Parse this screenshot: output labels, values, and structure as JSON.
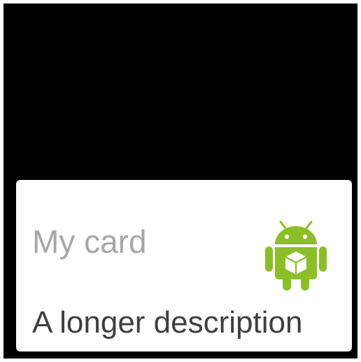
{
  "card": {
    "title": "My card",
    "description": "A longer description",
    "icon": "android-robot-cube-icon"
  },
  "colors": {
    "background": "#000000",
    "card": "#ffffff",
    "title": "#a7a7a7",
    "description": "#3f3f3f",
    "android_green": "#8cbf26"
  }
}
